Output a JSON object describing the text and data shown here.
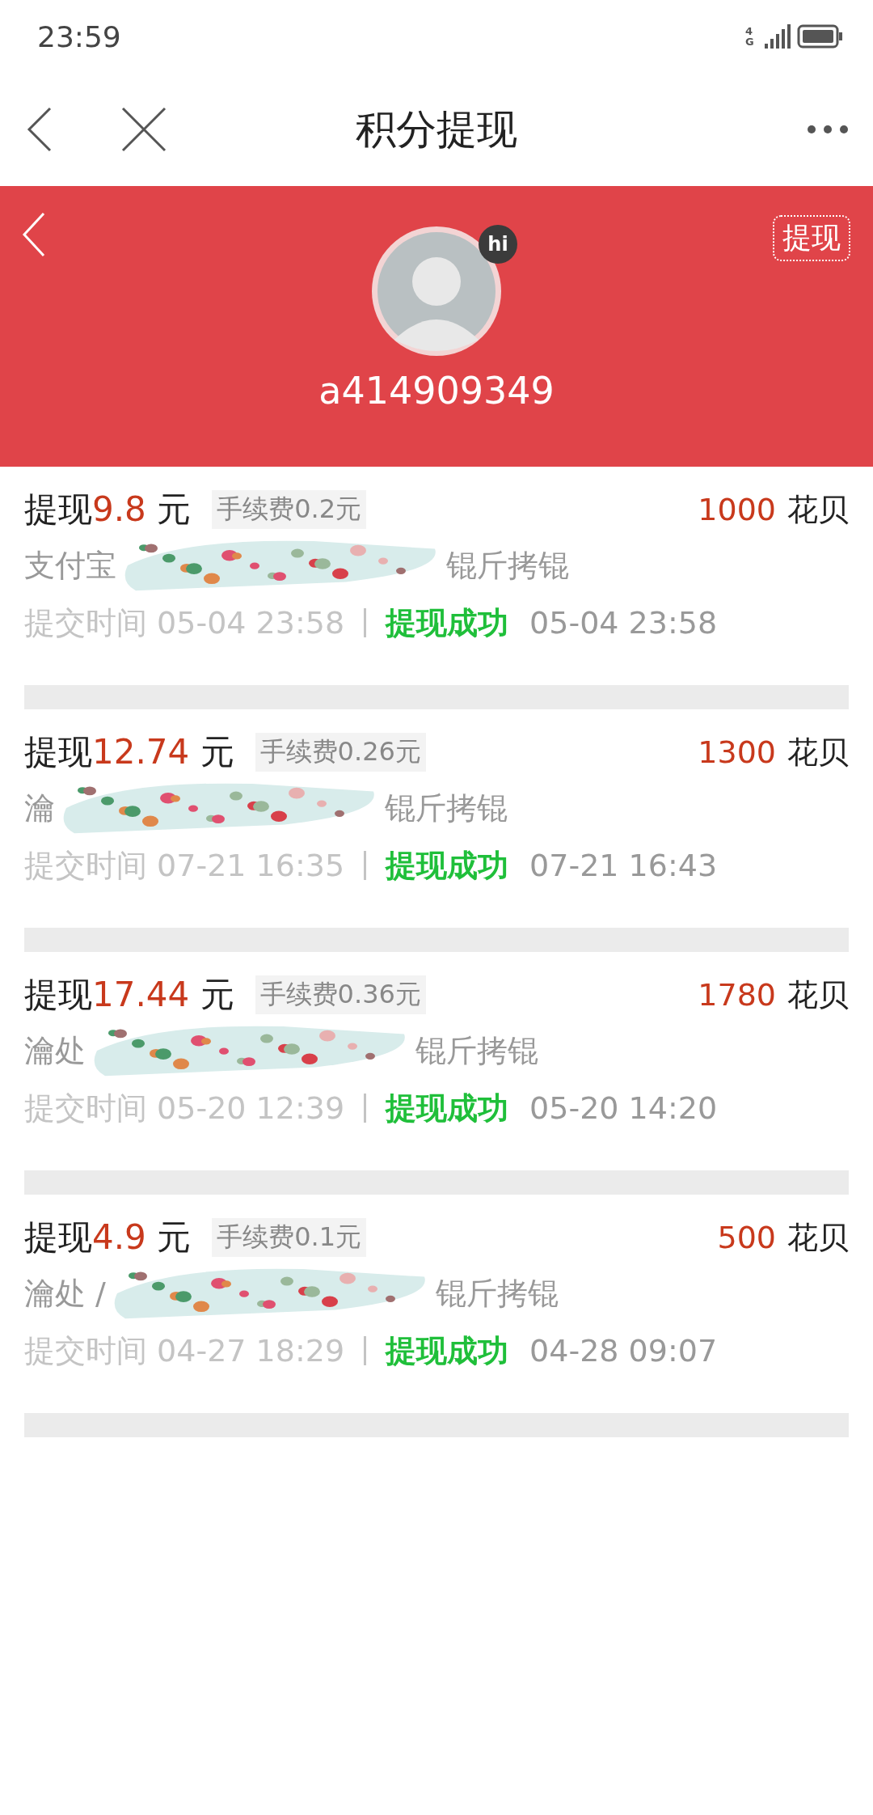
{
  "status_bar": {
    "time": "23:59",
    "network": "4G"
  },
  "nav": {
    "title": "积分提现"
  },
  "header": {
    "withdraw_button": "提现",
    "badge": "hi",
    "username": "a414909349"
  },
  "records": [
    {
      "label": "提现",
      "amount": "9.8",
      "unit": "元",
      "fee": "手续费0.2元",
      "points": "1000",
      "points_unit": "花贝",
      "account_prefix": "支付宝",
      "account_suffix": "锟斤拷锟",
      "submit_label": "提交时间",
      "submit_time": "05-04 23:58",
      "status": "提现成功",
      "done_time": "05-04 23:58"
    },
    {
      "label": "提现",
      "amount": "12.74",
      "unit": "元",
      "fee": "手续费0.26元",
      "points": "1300",
      "points_unit": "花贝",
      "account_prefix": "瀹",
      "account_suffix": "锟斤拷锟",
      "submit_label": "提交时间",
      "submit_time": "07-21 16:35",
      "status": "提现成功",
      "done_time": "07-21 16:43"
    },
    {
      "label": "提现",
      "amount": "17.44",
      "unit": "元",
      "fee": "手续费0.36元",
      "points": "1780",
      "points_unit": "花贝",
      "account_prefix": "瀹处",
      "account_suffix": "锟斤拷锟",
      "submit_label": "提交时间",
      "submit_time": "05-20 12:39",
      "status": "提现成功",
      "done_time": "05-20 14:20"
    },
    {
      "label": "提现",
      "amount": "4.9",
      "unit": "元",
      "fee": "手续费0.1元",
      "points": "500",
      "points_unit": "花贝",
      "account_prefix": "瀹处 /",
      "account_suffix": "锟斤拷锟",
      "submit_label": "提交时间",
      "submit_time": "04-27 18:29",
      "status": "提现成功",
      "done_time": "04-28 09:07"
    }
  ]
}
